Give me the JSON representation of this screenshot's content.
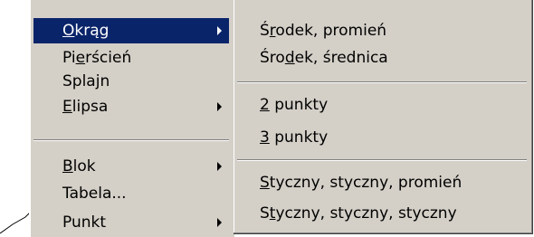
{
  "menu_parent": {
    "items": [
      {
        "pre": "",
        "key": "O",
        "post": "krąg",
        "has_submenu": true,
        "selected": true
      },
      {
        "pre": "Pi",
        "key": "e",
        "post": "rścień",
        "has_submenu": false,
        "selected": false
      },
      {
        "pre": "Spla",
        "key": "j",
        "post": "n",
        "has_submenu": false,
        "selected": false
      },
      {
        "pre": "",
        "key": "E",
        "post": "lipsa",
        "has_submenu": true,
        "selected": false
      },
      {
        "pre": "",
        "key": "B",
        "post": "lok",
        "has_submenu": true,
        "selected": false
      },
      {
        "pre": "Tabela...",
        "key": "",
        "post": "",
        "has_submenu": false,
        "selected": false
      },
      {
        "pre": "Punkt",
        "key": "",
        "post": "",
        "has_submenu": true,
        "selected": false
      }
    ]
  },
  "menu_submenu": {
    "items": [
      {
        "pre": "Ś",
        "key": "r",
        "post": "odek, promień"
      },
      {
        "pre": "Śro",
        "key": "d",
        "post": "ek, średnica"
      },
      {
        "pre": "",
        "key": "2",
        "post": " punkty"
      },
      {
        "pre": "",
        "key": "3",
        "post": " punkty"
      },
      {
        "pre": "",
        "key": "S",
        "post": "tyczny, styczny, promień"
      },
      {
        "pre": "S",
        "key": "t",
        "post": "yczny, styczny, styczny"
      }
    ]
  },
  "colors": {
    "menu_bg": "#d4d0c8",
    "highlight_bg": "#0a246a",
    "highlight_text": "#ffffff"
  }
}
